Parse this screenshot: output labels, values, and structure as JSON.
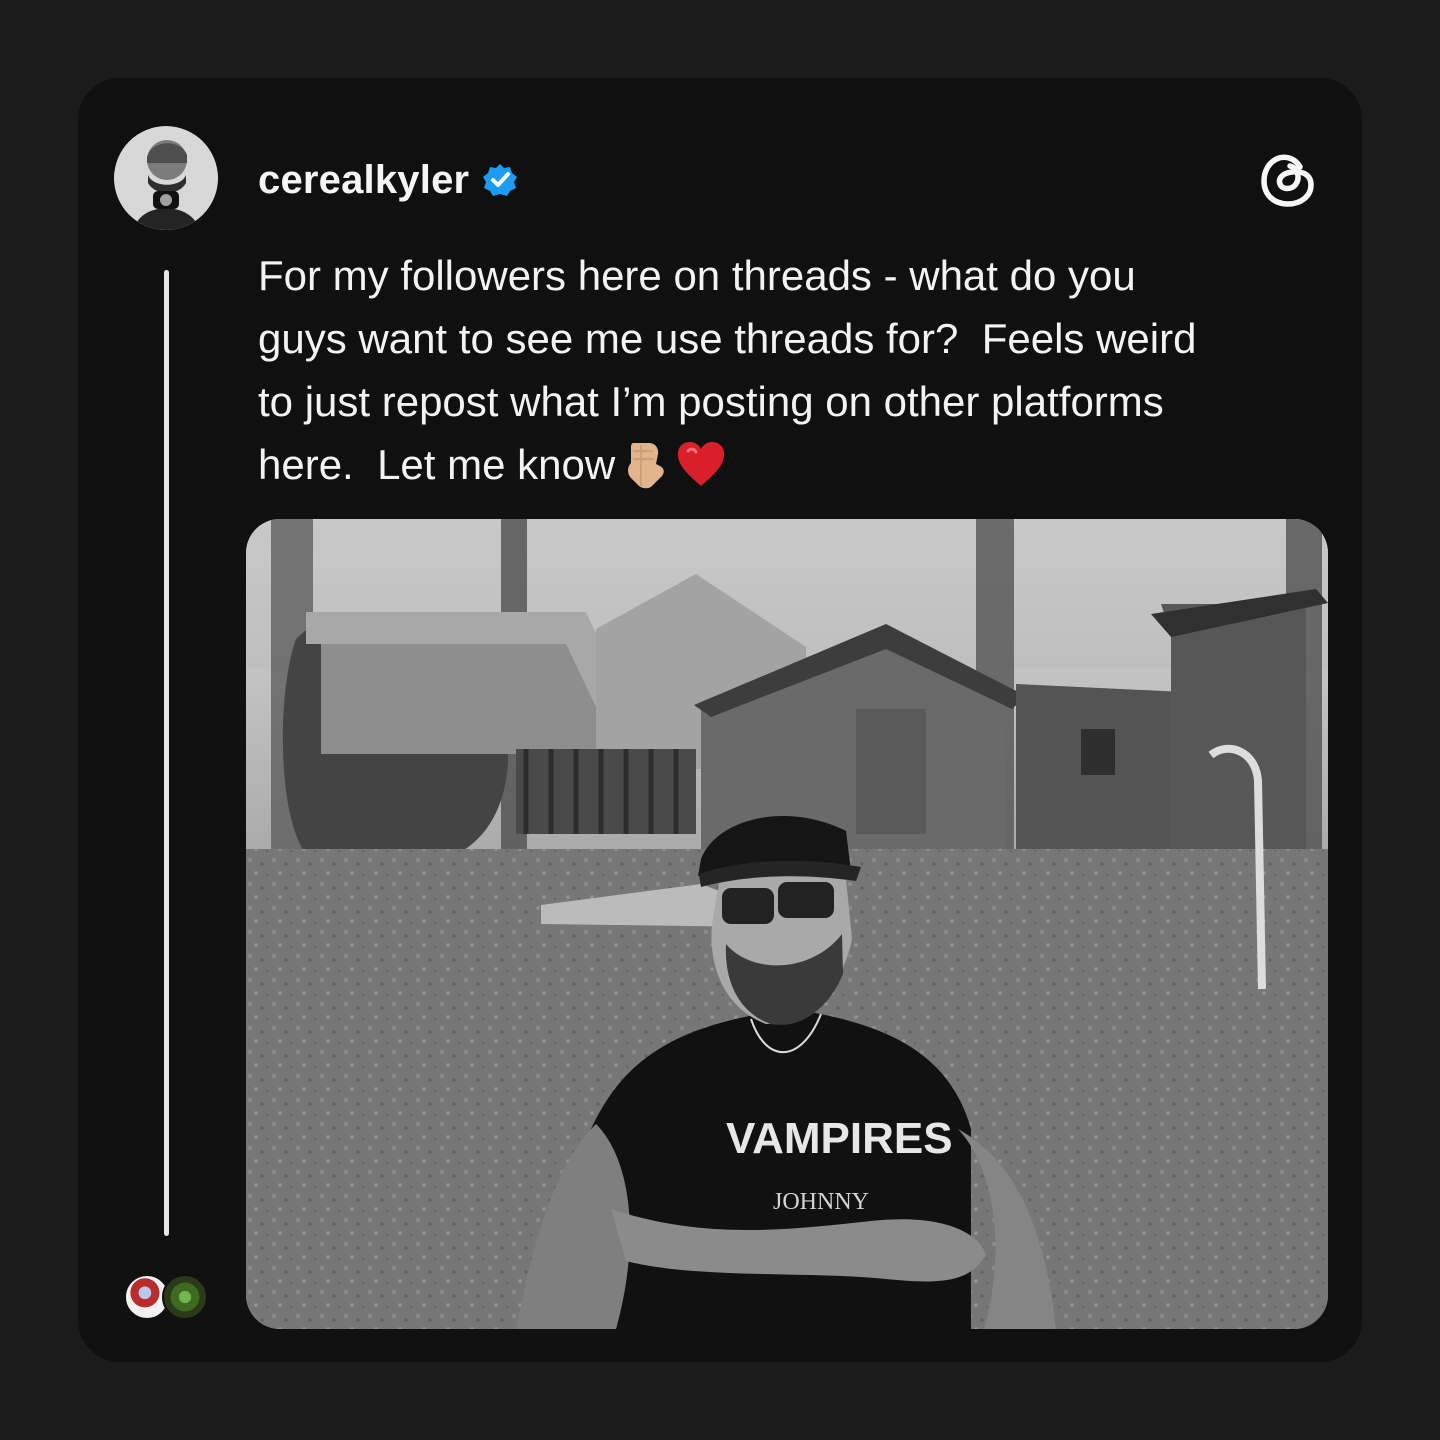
{
  "post": {
    "username": "cerealkyler",
    "text": "For my followers here on threads - what do you\nguys want to see me use threads for?  Feels weird\nto just repost what I’m posting on other platforms\nhere.  Let me know",
    "icons": [
      "verified-badge-icon",
      "threads-logo-icon",
      "pointing-down-icon",
      "heart-icon"
    ],
    "photo_shirt_text": "VAMPIRES",
    "photo_shirt_subtext": "JOHNNY"
  },
  "colors": {
    "background": "#1b1b1b",
    "card": "#101010",
    "text": "#f3f3f3",
    "verified": "#1d9bf0"
  }
}
